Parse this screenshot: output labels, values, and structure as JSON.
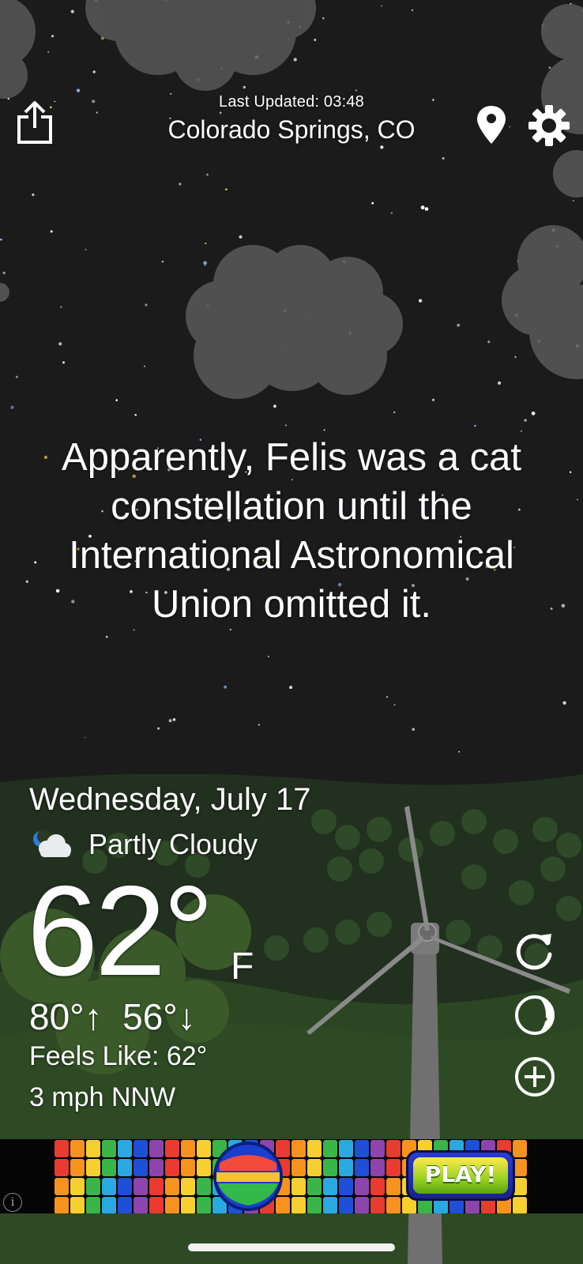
{
  "header": {
    "last_updated": "Last Updated: 03:48",
    "location": "Colorado Springs, CO",
    "share_icon": "share-icon",
    "pin_icon": "location-pin-icon",
    "settings_icon": "gear-icon"
  },
  "fact": {
    "lines": [
      "Apparently, Felis was a cat",
      "constellation until the",
      "International Astronomical",
      "Union omitted it."
    ]
  },
  "weather": {
    "date": "Wednesday, July 17",
    "condition": "Partly Cloudy",
    "condition_icon": "partly-cloudy-night-icon",
    "temperature": "62°",
    "unit": "F",
    "high": "80°",
    "low": "56°",
    "feels_like": "Feels Like: 62°",
    "wind": "3 mph NNW"
  },
  "controls": {
    "refresh_icon": "refresh-icon",
    "moon_icon": "moon-phase-icon",
    "add_icon": "add-circle-icon"
  },
  "ad": {
    "play_label": "PLAY!",
    "info_glyph": "i"
  },
  "colors": {
    "sky": "#1b1b1c",
    "hill_dark": "#24331f",
    "hill_light": "#2f4a25",
    "cloud": "#555555",
    "text": "#ffffff"
  }
}
